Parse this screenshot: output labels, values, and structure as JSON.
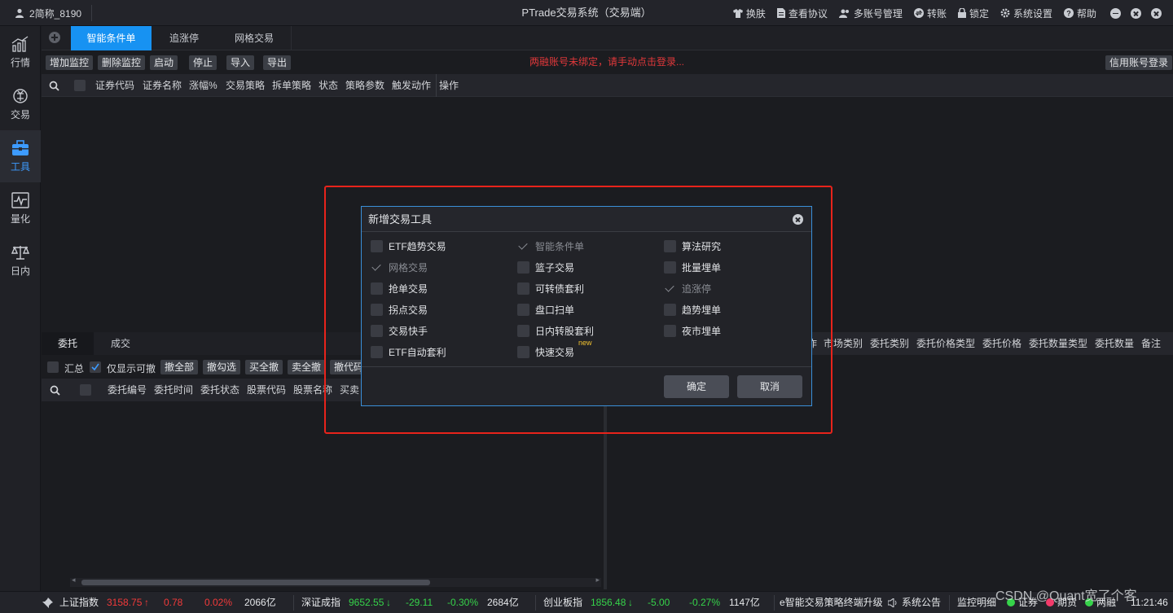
{
  "titlebar": {
    "user": "2简称_8190",
    "title": "PTrade交易系统（交易端）",
    "menu": [
      "换肤",
      "查看协议",
      "多账号管理",
      "转账",
      "锁定",
      "系统设置",
      "帮助"
    ]
  },
  "leftnav": [
    {
      "label": "行情",
      "icon": "chart-icon"
    },
    {
      "label": "交易",
      "icon": "exchange-icon"
    },
    {
      "label": "工具",
      "icon": "toolbox-icon"
    },
    {
      "label": "量化",
      "icon": "quant-icon"
    },
    {
      "label": "日内",
      "icon": "scale-icon"
    }
  ],
  "top_tabs": [
    "智能条件单",
    "追涨停",
    "网格交易"
  ],
  "toolbar": {
    "buttons": [
      "增加监控",
      "删除监控",
      "启动",
      "停止",
      "导入",
      "导出"
    ],
    "warning": "两融账号未绑定，请手动点击登录...",
    "credit_login": "信用账号登录"
  },
  "upper_columns": [
    "证券代码",
    "证券名称",
    "涨幅%",
    "交易策略",
    "拆单策略",
    "状态",
    "策略参数",
    "触发动作",
    "操作"
  ],
  "lower_tabs": [
    "委托",
    "成交"
  ],
  "lower_toolbar": {
    "summary": "汇总",
    "only_cancelable": "仅显示可撤",
    "buttons": [
      "撤全部",
      "撤勾选",
      "买全撤",
      "卖全撤",
      "撤代码"
    ]
  },
  "lower_columns": [
    "委托编号",
    "委托时间",
    "委托状态",
    "股票代码",
    "股票名称",
    "买卖"
  ],
  "right_columns": [
    "市场类别",
    "委托类别",
    "委托价格类型",
    "委托价格",
    "委托数量类型",
    "委托数量",
    "备注"
  ],
  "right_partial": "作",
  "dialog": {
    "title": "新增交易工具",
    "options": [
      {
        "label": "ETF趋势交易",
        "checked": false
      },
      {
        "label": "智能条件单",
        "checked": true
      },
      {
        "label": "算法研究",
        "checked": false
      },
      {
        "label": "网格交易",
        "checked": true
      },
      {
        "label": "篮子交易",
        "checked": false
      },
      {
        "label": "批量埋单",
        "checked": false
      },
      {
        "label": "抢单交易",
        "checked": false
      },
      {
        "label": "可转债套利",
        "checked": false
      },
      {
        "label": "追涨停",
        "checked": true
      },
      {
        "label": "拐点交易",
        "checked": false
      },
      {
        "label": "盘口扫单",
        "checked": false
      },
      {
        "label": "趋势埋单",
        "checked": false
      },
      {
        "label": "交易快手",
        "checked": false
      },
      {
        "label": "日内转股套利",
        "checked": false
      },
      {
        "label": "夜市埋单",
        "checked": false
      },
      {
        "label": "ETF自动套利",
        "checked": false
      },
      {
        "label": "快速交易",
        "checked": false,
        "tag": "new"
      }
    ],
    "ok": "确定",
    "cancel": "取消"
  },
  "statusbar": {
    "sh": {
      "name": "上证指数",
      "price": "3158.75",
      "arrow": "↑",
      "change": "0.78",
      "pct": "0.02%",
      "amount": "2066亿"
    },
    "sz": {
      "name": "深证成指",
      "price": "9652.55",
      "arrow": "↓",
      "change": "-29.11",
      "pct": "-0.30%",
      "amount": "2684亿"
    },
    "cy": {
      "name": "创业板指",
      "price": "1856.48",
      "arrow": "↓",
      "change": "-5.00",
      "pct": "-0.27%",
      "amount": "1147亿"
    },
    "ticker": "e智能交易策略终端升级",
    "announce": "系统公告",
    "monitor": "监控明细",
    "items": [
      "证券",
      "期货",
      "两融"
    ],
    "time": "11:21:46",
    "watermark": "CSDN @Quant宽了个客"
  },
  "colors": {
    "accent": "#1792f2",
    "warning": "#e0383a",
    "highlight": "#e8231b",
    "up": "#f23a3a",
    "down": "#36d34a"
  }
}
